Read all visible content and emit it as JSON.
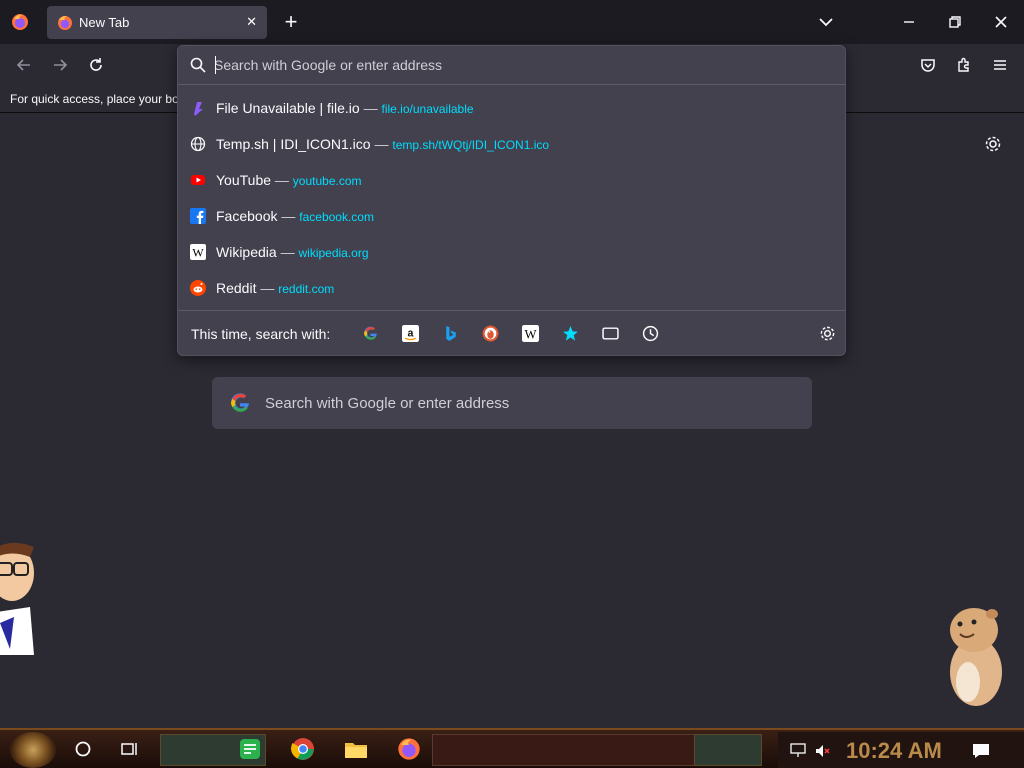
{
  "browser": {
    "tab": {
      "title": "New Tab"
    },
    "bookmarks_hint": "For quick access, place your bookmarks here on the bookmarks toolbar."
  },
  "urlbar": {
    "placeholder": "Search with Google or enter address",
    "results": [
      {
        "title": "File Unavailable | file.io",
        "sep": "—",
        "url": "file.io/unavailable",
        "icon": "fileio-icon"
      },
      {
        "title": "Temp.sh | IDI_ICON1.ico",
        "sep": "—",
        "url": "temp.sh/tWQtj/IDI_ICON1.ico",
        "icon": "globe-icon"
      },
      {
        "title": "YouTube",
        "sep": "—",
        "url": "youtube.com",
        "icon": "youtube-icon"
      },
      {
        "title": "Facebook",
        "sep": "—",
        "url": "facebook.com",
        "icon": "facebook-icon"
      },
      {
        "title": "Wikipedia",
        "sep": "—",
        "url": "wikipedia.org",
        "icon": "wikipedia-icon"
      },
      {
        "title": "Reddit",
        "sep": "—",
        "url": "reddit.com",
        "icon": "reddit-icon"
      }
    ],
    "search_with_label": "This time, search with:",
    "engines": [
      "google-icon",
      "amazon-icon",
      "bing-icon",
      "duckduckgo-icon",
      "wikipedia-icon",
      "bookmarks-star-icon",
      "tabs-icon",
      "history-icon"
    ]
  },
  "newtab": {
    "search_placeholder": "Search with Google or enter address"
  },
  "taskbar": {
    "clock": "10:24 AM"
  },
  "colors": {
    "accent_link": "#00ddff",
    "panel_bg": "#42414d",
    "page_bg": "#2b2a33"
  }
}
